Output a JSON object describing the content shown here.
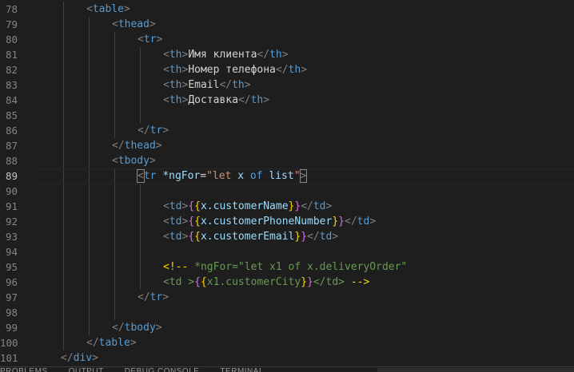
{
  "editor": {
    "lines": [
      {
        "n": "78",
        "tokens": [
          {
            "t": "<",
            "c": "punct"
          },
          {
            "t": "table",
            "c": "tag"
          },
          {
            "t": ">",
            "c": "punct"
          }
        ]
      },
      {
        "n": "79",
        "tokens": [
          {
            "t": "<",
            "c": "punct"
          },
          {
            "t": "thead",
            "c": "tag"
          },
          {
            "t": ">",
            "c": "punct"
          }
        ]
      },
      {
        "n": "80",
        "tokens": [
          {
            "t": "<",
            "c": "punct"
          },
          {
            "t": "tr",
            "c": "tag"
          },
          {
            "t": ">",
            "c": "punct"
          }
        ]
      },
      {
        "n": "81",
        "tokens": [
          {
            "t": "<",
            "c": "punct"
          },
          {
            "t": "th",
            "c": "tag"
          },
          {
            "t": ">",
            "c": "punct"
          },
          {
            "t": "Имя клиента",
            "c": "text"
          },
          {
            "t": "</",
            "c": "punct"
          },
          {
            "t": "th",
            "c": "tag"
          },
          {
            "t": ">",
            "c": "punct"
          }
        ]
      },
      {
        "n": "82",
        "tokens": [
          {
            "t": "<",
            "c": "punct"
          },
          {
            "t": "th",
            "c": "tag"
          },
          {
            "t": ">",
            "c": "punct"
          },
          {
            "t": "Номер телефона",
            "c": "text"
          },
          {
            "t": "</",
            "c": "punct"
          },
          {
            "t": "th",
            "c": "tag"
          },
          {
            "t": ">",
            "c": "punct"
          }
        ]
      },
      {
        "n": "83",
        "tokens": [
          {
            "t": "<",
            "c": "punct"
          },
          {
            "t": "th",
            "c": "tag"
          },
          {
            "t": ">",
            "c": "punct"
          },
          {
            "t": "Email",
            "c": "text"
          },
          {
            "t": "</",
            "c": "punct"
          },
          {
            "t": "th",
            "c": "tag"
          },
          {
            "t": ">",
            "c": "punct"
          }
        ]
      },
      {
        "n": "84",
        "tokens": [
          {
            "t": "<",
            "c": "punct"
          },
          {
            "t": "th",
            "c": "tag"
          },
          {
            "t": ">",
            "c": "punct"
          },
          {
            "t": "Доставка",
            "c": "text"
          },
          {
            "t": "</",
            "c": "punct"
          },
          {
            "t": "th",
            "c": "tag"
          },
          {
            "t": ">",
            "c": "punct"
          }
        ]
      },
      {
        "n": "85",
        "tokens": []
      },
      {
        "n": "86",
        "tokens": [
          {
            "t": "</",
            "c": "punct"
          },
          {
            "t": "tr",
            "c": "tag"
          },
          {
            "t": ">",
            "c": "punct"
          }
        ]
      },
      {
        "n": "87",
        "tokens": [
          {
            "t": "</",
            "c": "punct"
          },
          {
            "t": "thead",
            "c": "tag"
          },
          {
            "t": ">",
            "c": "punct"
          }
        ]
      },
      {
        "n": "88",
        "tokens": [
          {
            "t": "<",
            "c": "punct"
          },
          {
            "t": "tbody",
            "c": "tag"
          },
          {
            "t": ">",
            "c": "punct"
          }
        ]
      },
      {
        "n": "89",
        "tokens": [
          {
            "t": "<",
            "c": "punct",
            "hl": true
          },
          {
            "t": "tr",
            "c": "tag"
          },
          {
            "t": " ",
            "c": "text"
          },
          {
            "t": "*ngFor",
            "c": "attr"
          },
          {
            "t": "=",
            "c": "text"
          },
          {
            "t": "\"let ",
            "c": "str"
          },
          {
            "t": "x",
            "c": "prop"
          },
          {
            "t": " of ",
            "c": "kw"
          },
          {
            "t": "list",
            "c": "prop"
          },
          {
            "t": "\"",
            "c": "str"
          },
          {
            "t": ">",
            "c": "punct",
            "hl": true
          }
        ]
      },
      {
        "n": "90",
        "tokens": []
      },
      {
        "n": "91",
        "tokens": [
          {
            "t": "<",
            "c": "punct"
          },
          {
            "t": "td",
            "c": "tag"
          },
          {
            "t": ">",
            "c": "punct"
          },
          {
            "t": "{",
            "c": "brace"
          },
          {
            "t": "{",
            "c": "brace2"
          },
          {
            "t": "x.customerName",
            "c": "prop"
          },
          {
            "t": "}",
            "c": "brace2"
          },
          {
            "t": "}",
            "c": "brace"
          },
          {
            "t": "</",
            "c": "punct"
          },
          {
            "t": "td",
            "c": "tag"
          },
          {
            "t": ">",
            "c": "punct"
          }
        ]
      },
      {
        "n": "92",
        "tokens": [
          {
            "t": "<",
            "c": "punct"
          },
          {
            "t": "td",
            "c": "tag"
          },
          {
            "t": ">",
            "c": "punct"
          },
          {
            "t": "{",
            "c": "brace"
          },
          {
            "t": "{",
            "c": "brace2"
          },
          {
            "t": "x.customerPhoneNumber",
            "c": "prop"
          },
          {
            "t": "}",
            "c": "brace2"
          },
          {
            "t": "}",
            "c": "brace"
          },
          {
            "t": "</",
            "c": "punct"
          },
          {
            "t": "td",
            "c": "tag"
          },
          {
            "t": ">",
            "c": "punct"
          }
        ]
      },
      {
        "n": "93",
        "tokens": [
          {
            "t": "<",
            "c": "punct"
          },
          {
            "t": "td",
            "c": "tag"
          },
          {
            "t": ">",
            "c": "punct"
          },
          {
            "t": "{",
            "c": "brace"
          },
          {
            "t": "{",
            "c": "brace2"
          },
          {
            "t": "x.customerEmail",
            "c": "prop"
          },
          {
            "t": "}",
            "c": "brace2"
          },
          {
            "t": "}",
            "c": "brace"
          },
          {
            "t": "</",
            "c": "punct"
          },
          {
            "t": "td",
            "c": "tag"
          },
          {
            "t": ">",
            "c": "punct"
          }
        ]
      },
      {
        "n": "94",
        "tokens": []
      },
      {
        "n": "95",
        "tokens": [
          {
            "t": "<!-- ",
            "c": "brace2"
          },
          {
            "t": "*ngFor=\"let x1 of x.deliveryOrder\"",
            "c": "comment"
          }
        ]
      },
      {
        "n": "96",
        "tokens": [
          {
            "t": "<td >",
            "c": "comment"
          },
          {
            "t": "{",
            "c": "brace"
          },
          {
            "t": "{",
            "c": "brace2"
          },
          {
            "t": "x1.customerCity",
            "c": "comment"
          },
          {
            "t": "}",
            "c": "brace2"
          },
          {
            "t": "}",
            "c": "brace"
          },
          {
            "t": "</td> ",
            "c": "comment"
          },
          {
            "t": "-->",
            "c": "brace2"
          }
        ]
      },
      {
        "n": "97",
        "tokens": [
          {
            "t": "</",
            "c": "punct"
          },
          {
            "t": "tr",
            "c": "tag"
          },
          {
            "t": ">",
            "c": "punct"
          }
        ]
      },
      {
        "n": "98",
        "tokens": []
      },
      {
        "n": "99",
        "tokens": [
          {
            "t": "</",
            "c": "punct"
          },
          {
            "t": "tbody",
            "c": "tag"
          },
          {
            "t": ">",
            "c": "punct"
          }
        ]
      },
      {
        "n": "100",
        "tokens": [
          {
            "t": "</",
            "c": "punct"
          },
          {
            "t": "table",
            "c": "tag"
          },
          {
            "t": ">",
            "c": "punct"
          }
        ]
      },
      {
        "n": "101",
        "tokens": [
          {
            "t": "</",
            "c": "punct"
          },
          {
            "t": "div",
            "c": "tag"
          },
          {
            "t": ">",
            "c": "punct"
          }
        ]
      }
    ],
    "current_line": "89"
  },
  "panel": {
    "tabs": [
      "PROBLEMS",
      "OUTPUT",
      "DEBUG CONSOLE",
      "TERMINAL"
    ]
  }
}
